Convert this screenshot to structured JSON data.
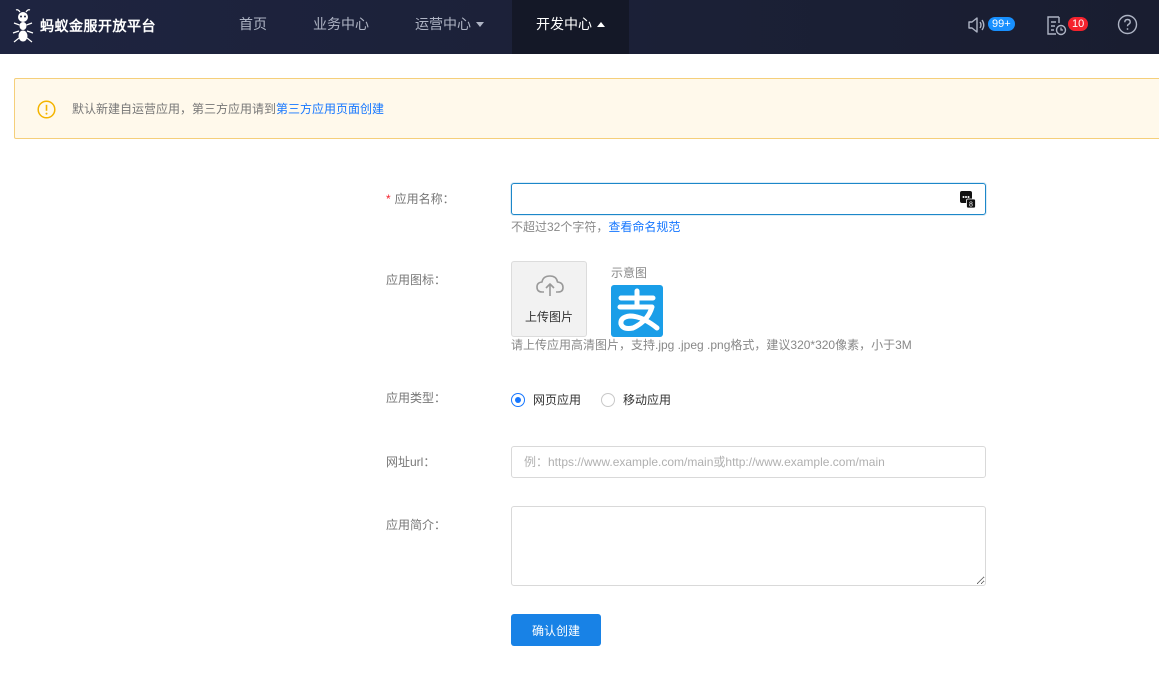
{
  "brand": {
    "name": "蚂蚁金服开放平台",
    "logo_icon": "ant-logo-icon"
  },
  "nav": {
    "items": [
      {
        "label": "首页"
      },
      {
        "label": "业务中心"
      },
      {
        "label": "运营中心",
        "dropdown": true
      },
      {
        "label": "开发中心",
        "dropdown": true,
        "active": true
      }
    ]
  },
  "toolbar": {
    "notification_badge": "99+",
    "tasks_badge": "10",
    "help_icon": "help-icon"
  },
  "alert": {
    "text": "默认新建自运营应用，第三方应用请到",
    "link": "第三方应用页面创建"
  },
  "form": {
    "name": {
      "label": "应用名称：",
      "required_mark": "*",
      "value": "",
      "help_text": "不超过32个字符，",
      "help_link": "查看命名规范"
    },
    "icon": {
      "label": "应用图标：",
      "upload_label": "上传图片",
      "sample_title": "示意图",
      "help_text": "请上传应用高清图片，支持.jpg .jpeg .png格式，建议320*320像素，小于3M"
    },
    "type": {
      "label": "应用类型：",
      "options": [
        "网页应用",
        "移动应用"
      ],
      "selected": "网页应用"
    },
    "url": {
      "label": "网址url：",
      "value": "",
      "placeholder": "例：https://www.example.com/main或http://www.example.com/main"
    },
    "intro": {
      "label": "应用简介：",
      "value": ""
    },
    "submit_label": "确认创建"
  },
  "colors": {
    "nav_bg": "#1e2440",
    "accent": "#1882e6",
    "link": "#1677ff",
    "alert_bg": "#fff9eb",
    "alert_border": "#f5cf7a",
    "badge_red": "#f5222d"
  }
}
